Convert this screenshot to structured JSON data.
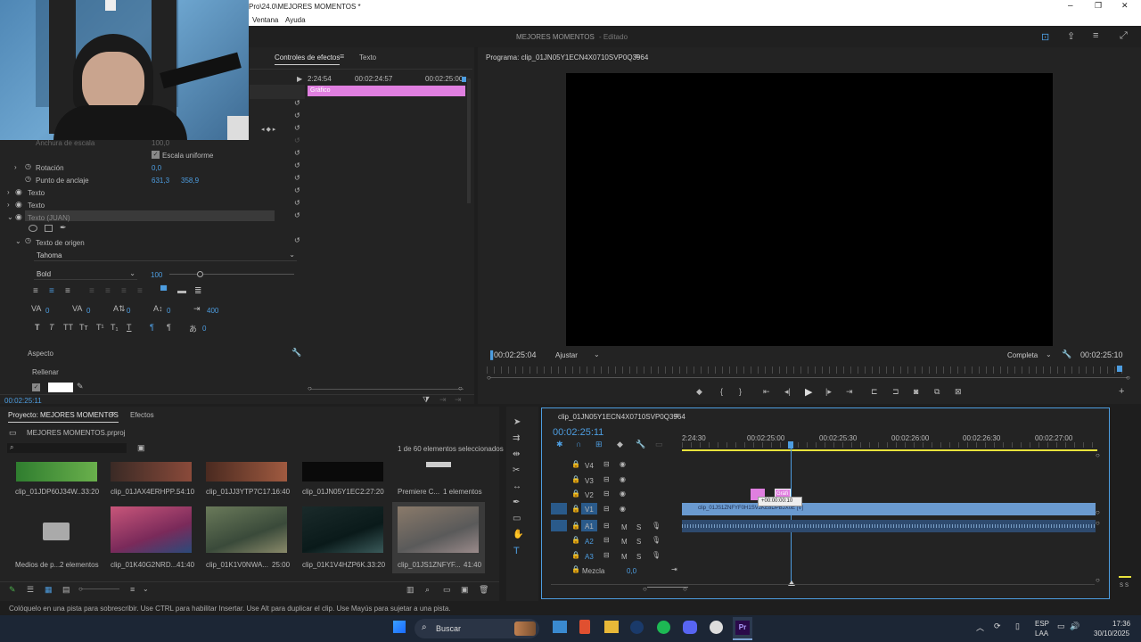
{
  "window": {
    "title": "Pro\\24.0\\MEJORES MOMENTOS *",
    "menu": [
      "Ventana",
      "Ayuda"
    ],
    "project_name": "MEJORES MOMENTOS",
    "project_state": "- Editado"
  },
  "effects_panel": {
    "tabs": [
      "Controles de efectos",
      "Texto"
    ],
    "time_labels": [
      "2:24:54",
      "00:02:24:57",
      "00:02:25:00"
    ],
    "graphic_label": "Gráfico",
    "properties": {
      "scale_width_label": "Anchura de escala",
      "scale_width_value": "100,0",
      "uniform_scale": "Escala uniforme",
      "rotation_label": "Rotación",
      "rotation_value": "0,0",
      "anchor_label": "Punto de anclaje",
      "anchor_x": "631,3",
      "anchor_y": "358,9",
      "layers": [
        "Texto",
        "Texto",
        "Texto (JUAN)"
      ],
      "source_text_label": "Texto de origen",
      "font_family": "Tahoma",
      "font_style": "Bold",
      "font_size": "100",
      "tracking_values": [
        "0",
        "0",
        "0",
        "0",
        "400",
        "0"
      ],
      "appearance_label": "Aspecto",
      "fill_label": "Rellenar"
    },
    "current_time": "00:02:25:11"
  },
  "program_monitor": {
    "title": "Programa: clip_01JN05Y1ECN4X0710SVP0Q3964",
    "current_time": "00:02:25:04",
    "fit": "Ajustar",
    "quality": "Completa",
    "end_time": "00:02:25:10"
  },
  "project_panel": {
    "tabs": [
      "Proyecto: MEJORES MOMENTOS",
      "Efectos"
    ],
    "file": "MEJORES MOMENTOS.prproj",
    "selection_status": "1 de 60 elementos seleccionados",
    "items": [
      {
        "name": "clip_01JDP60J34W...",
        "duration": "33:20"
      },
      {
        "name": "clip_01JAX4ERHPP...",
        "duration": "54:10"
      },
      {
        "name": "clip_01JJ3YTP7C17...",
        "duration": "16:40"
      },
      {
        "name": "clip_01JN05Y1EC...",
        "duration": "2:27:20"
      },
      {
        "name": "Premiere C...",
        "duration": "1 elementos"
      },
      {
        "name": "Medios de p...",
        "duration": "2 elementos"
      },
      {
        "name": "clip_01K40G2NRD...",
        "duration": "41:40"
      },
      {
        "name": "clip_01K1V0NWA...",
        "duration": "25:00"
      },
      {
        "name": "clip_01K1V4HZP6K...",
        "duration": "33:20"
      },
      {
        "name": "clip_01JS1ZNFYF...",
        "duration": "41:40"
      }
    ]
  },
  "timeline": {
    "title": "clip_01JN05Y1ECN4X0710SVP0Q3964",
    "current_time": "00:02:25:11",
    "ruler": [
      "2:24:30",
      "00:02:25:00",
      "00:02:25:30",
      "00:02:26:00",
      "00:02:26:30",
      "00:02:27:00"
    ],
    "video_tracks": [
      "V4",
      "V3",
      "V2",
      "V1"
    ],
    "audio_tracks": [
      "A1",
      "A2",
      "A3"
    ],
    "mix_label": "Mezcla",
    "mix_value": "0,0",
    "clip_label": "clip_01JS1ZNFYF0H1SV2KE8DPBJX0E [V]",
    "graphic_clip": "Gráfi",
    "drag_tooltip": "+00:00:00:10",
    "mute": "M",
    "solo": "S"
  },
  "status_bar": "Colóquelo en una pista para sobrescribir. Use CTRL para habilitar Insertar. Use Alt para duplicar el clip. Use Mayús para sujetar a una pista.",
  "taskbar": {
    "search": "Buscar",
    "lang": "ESP",
    "layout": "LAA",
    "time": "17:36",
    "date": "30/10/2025"
  },
  "colors": {
    "accent": "#4d9de0",
    "graphic": "#e07fe0",
    "clip": "#6a9ad0",
    "yellow": "#e8e23c"
  }
}
